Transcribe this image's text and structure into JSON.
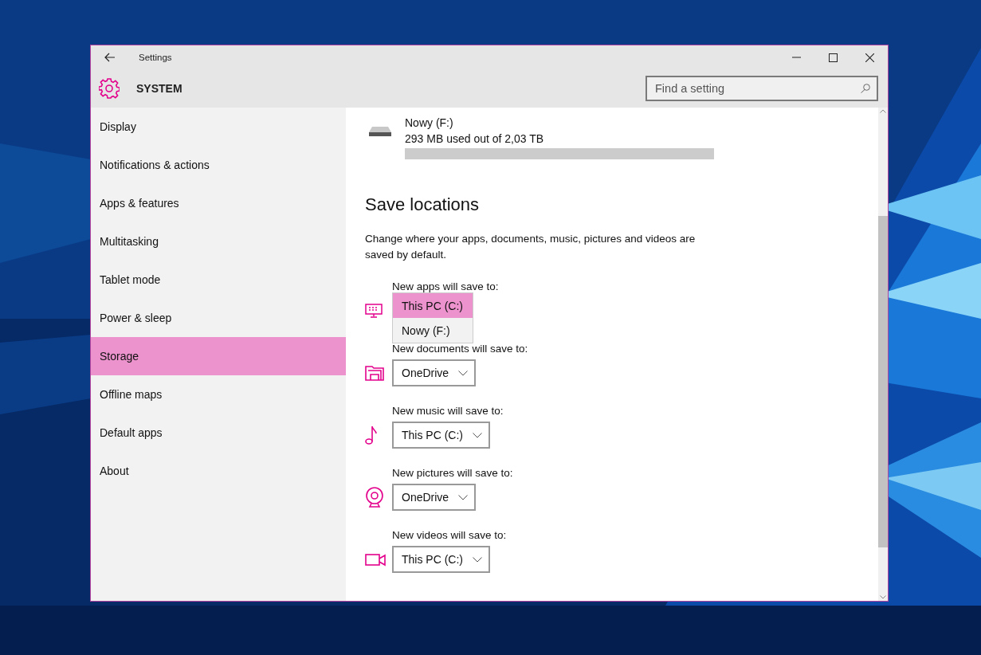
{
  "window": {
    "title": "Settings",
    "section": "SYSTEM"
  },
  "search": {
    "placeholder": "Find a setting"
  },
  "sidebar": {
    "items": [
      {
        "label": "Display",
        "selected": false
      },
      {
        "label": "Notifications & actions",
        "selected": false
      },
      {
        "label": "Apps & features",
        "selected": false
      },
      {
        "label": "Multitasking",
        "selected": false
      },
      {
        "label": "Tablet mode",
        "selected": false
      },
      {
        "label": "Power & sleep",
        "selected": false
      },
      {
        "label": "Storage",
        "selected": true
      },
      {
        "label": "Offline maps",
        "selected": false
      },
      {
        "label": "Default apps",
        "selected": false
      },
      {
        "label": "About",
        "selected": false
      }
    ]
  },
  "drive": {
    "name": "Nowy (F:)",
    "usage": "293 MB used out of 2,03 TB",
    "level": 0
  },
  "save_locations": {
    "heading": "Save locations",
    "description": "Change where your apps, documents, music, pictures and videos are saved by default.",
    "rows": [
      {
        "kind": "apps",
        "label": "New apps will save to:",
        "expanded": true,
        "options": [
          {
            "label": "This PC (C:)",
            "selected": true
          },
          {
            "label": "Nowy (F:)",
            "selected": false
          }
        ]
      },
      {
        "kind": "documents",
        "label": "New documents will save to:",
        "expanded": false,
        "value": "OneDrive"
      },
      {
        "kind": "music",
        "label": "New music will save to:",
        "expanded": false,
        "value": "This PC (C:)"
      },
      {
        "kind": "pictures",
        "label": "New pictures will save to:",
        "expanded": false,
        "value": "OneDrive"
      },
      {
        "kind": "videos",
        "label": "New videos will save to:",
        "expanded": false,
        "value": "This PC (C:)"
      }
    ]
  }
}
